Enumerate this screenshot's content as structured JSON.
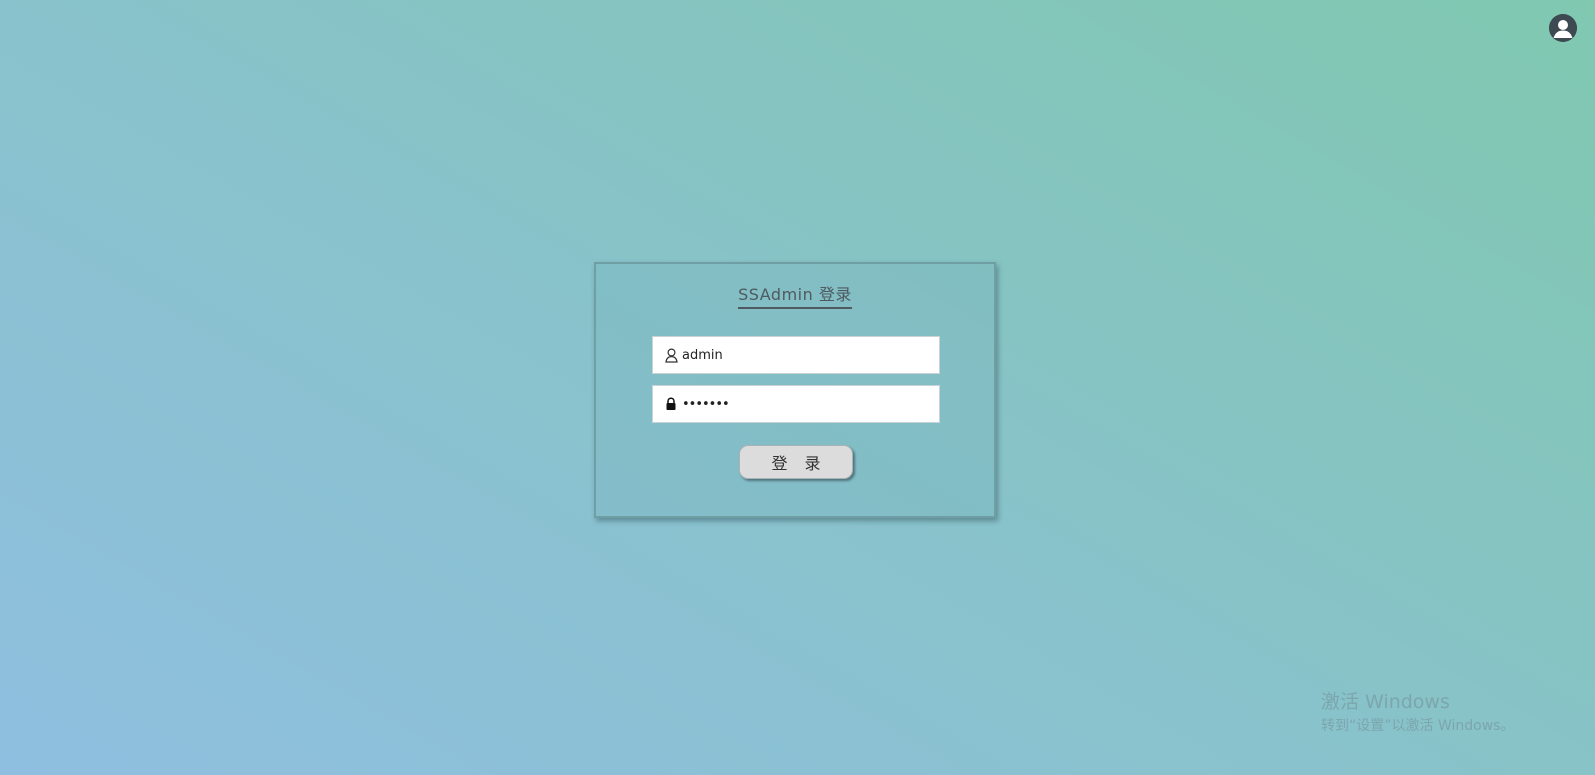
{
  "header": {
    "account_icon": "user-circle-icon"
  },
  "login": {
    "title": "SSAdmin 登录",
    "username": {
      "icon": "user-icon",
      "value": "admin"
    },
    "password": {
      "icon": "lock-icon",
      "value": "•••••••"
    },
    "submit_label": "登 录"
  },
  "watermark": {
    "title": "激活 Windows",
    "subtitle": "转到“设置”以激活 Windows。"
  },
  "colors": {
    "background_start": "#8fbfe0",
    "background_end": "#80c8b0",
    "title_text": "#4f5a60",
    "button_bg": "#dcdcdc"
  }
}
